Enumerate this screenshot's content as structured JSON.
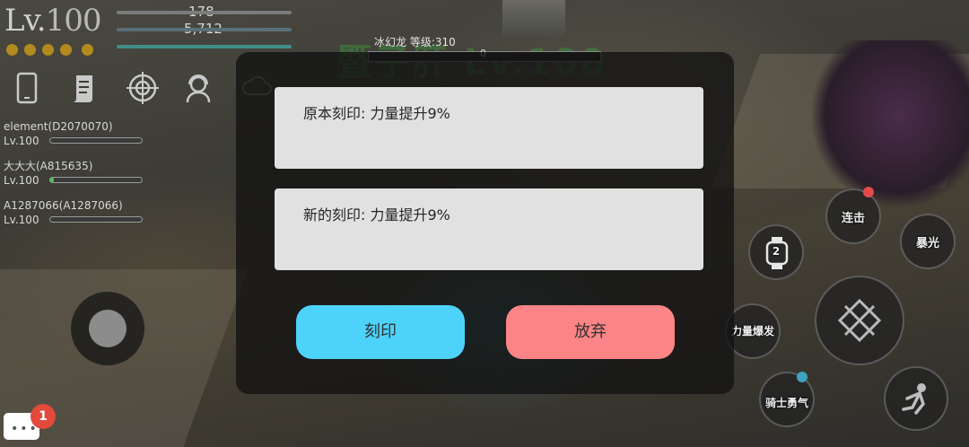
{
  "hud": {
    "level_prefix": "Lv.",
    "level_value": "100",
    "hp": "178",
    "exp": "5,712"
  },
  "boss": {
    "name": "冰幻龙 等级:310",
    "title": "暨子肝 Lv.100",
    "hp_value": "0"
  },
  "party": [
    {
      "name": "element(D2070070)",
      "level": "Lv.100"
    },
    {
      "name": "大大大(A815635)",
      "level": "Lv.100"
    },
    {
      "name": "A1287066(A1287066)",
      "level": "Lv.100"
    }
  ],
  "menu_icons": [
    "phone-icon",
    "scroll-icon",
    "crosshair-icon",
    "support-agent-icon",
    "cloud-icon"
  ],
  "chat": {
    "badge_count": "1"
  },
  "skills": {
    "combo": "连击",
    "burst": "暴光",
    "power_burst": "力量爆发",
    "knight_courage": "骑士勇气",
    "watch_label": "2"
  },
  "dialog": {
    "original_engraving": "原本刻印: 力量提升9%",
    "new_engraving": "新的刻印: 力量提升9%",
    "engrave_button": "刻印",
    "abandon_button": "放弃"
  },
  "colors": {
    "engrave": "#4dd3fa",
    "abandon": "#fb8586",
    "badge": "#e24a3b"
  }
}
